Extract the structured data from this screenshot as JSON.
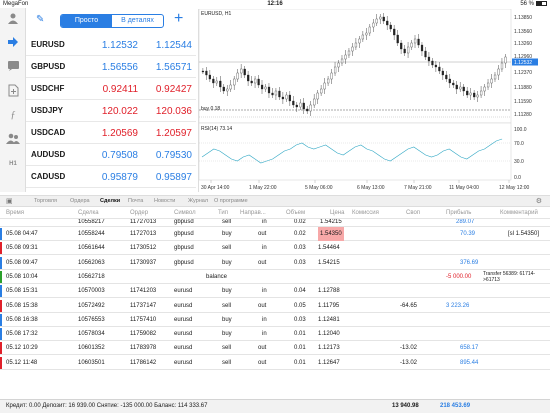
{
  "status_bar": {
    "carrier": "MegaFon",
    "time": "12:16",
    "battery": "56 %"
  },
  "quotes_header": {
    "tab_simple": "Просто",
    "tab_detailed": "В деталях"
  },
  "quotes": [
    {
      "symbol": "EURUSD",
      "bid": "1.12532",
      "ask": "1.12544",
      "dir": "up"
    },
    {
      "symbol": "GBPUSD",
      "bid": "1.56556",
      "ask": "1.56571",
      "dir": "up"
    },
    {
      "symbol": "USDCHF",
      "bid": "0.92411",
      "ask": "0.92427",
      "dir": "down"
    },
    {
      "symbol": "USDJPY",
      "bid": "120.022",
      "ask": "120.036",
      "dir": "down"
    },
    {
      "symbol": "USDCAD",
      "bid": "1.20569",
      "ask": "1.20597",
      "dir": "down"
    },
    {
      "symbol": "AUDUSD",
      "bid": "0.79508",
      "ask": "0.79530",
      "dir": "up"
    },
    {
      "symbol": "CADUSD",
      "bid": "0.95879",
      "ask": "0.95897",
      "dir": "up"
    }
  ],
  "sidebar": {
    "h1_label": "H1"
  },
  "chart": {
    "title": "EURUSD, H1",
    "buy_label": "buy 0.18",
    "rsi_title": "RSI(14) 73.14",
    "price_ticks": [
      "1.13850",
      "1.13560",
      "1.13260",
      "1.12960",
      "1.12532",
      "1.12370",
      "1.11880",
      "1.11590",
      "1.11280",
      "100.0",
      "70.0",
      "30.0",
      "0.0"
    ],
    "time_ticks": [
      "30 Apr 14:00",
      "1 May 22:00",
      "5 May 06:00",
      "6 May 13:00",
      "7 May 21:00",
      "11 May 04:00",
      "12 May 12:00"
    ],
    "current_price": "1.12532"
  },
  "bottom_tabs": [
    "Торговля",
    "Ордера",
    "Сделки",
    "Почта",
    "Новости",
    "Журнал",
    "О программе"
  ],
  "active_tab": "Сделки",
  "table_headers": {
    "time": "Время",
    "deal": "Сделка",
    "order": "Ордер",
    "symbol": "Символ",
    "type": "Тип",
    "direction": "Направ...",
    "volume": "Объем",
    "price": "Цена",
    "commission": "Комиссия",
    "swap": "Своп",
    "profit": "Прибыль",
    "comment": "Комментарий"
  },
  "partial_row": {
    "deal": "10558217",
    "order": "11727013",
    "symbol": "gbpusd",
    "type": "sell",
    "direction": "in",
    "volume": "0.02",
    "price": "1.54215",
    "profit": "289.07"
  },
  "deals": [
    {
      "time": "05.08 04:47",
      "deal": "10558244",
      "order": "11727013",
      "symbol": "gbpusd",
      "type": "buy",
      "direction": "out",
      "volume": "0.02",
      "price": "1.54350",
      "commission": "",
      "swap": "",
      "profit": "70.39",
      "comment": "[sl 1.54350]",
      "marker": "#2a7ee3",
      "price_highlight": true,
      "profit_sign": "pos"
    },
    {
      "time": "05.08 09:31",
      "deal": "10561644",
      "order": "11730512",
      "symbol": "gbpusd",
      "type": "sell",
      "direction": "in",
      "volume": "0.03",
      "price": "1.54464",
      "commission": "",
      "swap": "",
      "profit": "",
      "comment": "",
      "marker": "#e0202a",
      "price_highlight": false,
      "profit_sign": "pos"
    },
    {
      "time": "05.08 09:47",
      "deal": "10562063",
      "order": "11730937",
      "symbol": "gbpusd",
      "type": "buy",
      "direction": "out",
      "volume": "0.03",
      "price": "1.54215",
      "commission": "",
      "swap": "",
      "profit": "376.69",
      "comment": "",
      "marker": "#2a7ee3",
      "price_highlight": false,
      "profit_sign": "pos"
    },
    {
      "time": "05.08 10:04",
      "deal": "10562718",
      "order": "",
      "symbol": "",
      "type": "balance",
      "direction": "",
      "volume": "",
      "price": "",
      "commission": "",
      "swap": "",
      "profit": "-5 000.00",
      "comment": "Transfer 56389: 61714->61713",
      "marker": "#2ca02c",
      "price_highlight": false,
      "profit_sign": "neg"
    },
    {
      "time": "05.08 15:31",
      "deal": "10570003",
      "order": "11741203",
      "symbol": "eurusd",
      "type": "buy",
      "direction": "in",
      "volume": "0.04",
      "price": "1.12788",
      "commission": "",
      "swap": "",
      "profit": "",
      "comment": "",
      "marker": "#2a7ee3",
      "price_highlight": false,
      "profit_sign": "pos"
    },
    {
      "time": "05.08 15:38",
      "deal": "10572492",
      "order": "11737147",
      "symbol": "eurusd",
      "type": "sell",
      "direction": "out",
      "volume": "0.05",
      "price": "1.11795",
      "commission": "",
      "swap": "-64.65",
      "profit": "3 223.26",
      "comment": "",
      "marker": "#e0202a",
      "price_highlight": false,
      "profit_sign": "pos"
    },
    {
      "time": "05.08 16:38",
      "deal": "10576553",
      "order": "11757410",
      "symbol": "eurusd",
      "type": "buy",
      "direction": "in",
      "volume": "0.03",
      "price": "1.12481",
      "commission": "",
      "swap": "",
      "profit": "",
      "comment": "",
      "marker": "#2a7ee3",
      "price_highlight": false,
      "profit_sign": "pos"
    },
    {
      "time": "05.08 17:32",
      "deal": "10578034",
      "order": "11759082",
      "symbol": "eurusd",
      "type": "buy",
      "direction": "in",
      "volume": "0.01",
      "price": "1.12040",
      "commission": "",
      "swap": "",
      "profit": "",
      "comment": "",
      "marker": "#2a7ee3",
      "price_highlight": false,
      "profit_sign": "pos"
    },
    {
      "time": "05.12 10:29",
      "deal": "10601352",
      "order": "11783978",
      "symbol": "eurusd",
      "type": "sell",
      "direction": "out",
      "volume": "0.01",
      "price": "1.12173",
      "commission": "",
      "swap": "-13.02",
      "profit": "658.17",
      "comment": "",
      "marker": "#e0202a",
      "price_highlight": false,
      "profit_sign": "pos"
    },
    {
      "time": "05.12 11:48",
      "deal": "10603501",
      "order": "11786142",
      "symbol": "eurusd",
      "type": "sell",
      "direction": "out",
      "volume": "0.01",
      "price": "1.12647",
      "commission": "",
      "swap": "-13.02",
      "profit": "895.44",
      "comment": "",
      "marker": "#e0202a",
      "price_highlight": false,
      "profit_sign": "pos"
    }
  ],
  "footer": {
    "summary": "Кредит: 0.00 Депозит: 16 939.00 Снятие: -135 000.00 Баланс: 114 333.67",
    "total_swap": "13 940.98",
    "total_profit": "218 453.69"
  }
}
